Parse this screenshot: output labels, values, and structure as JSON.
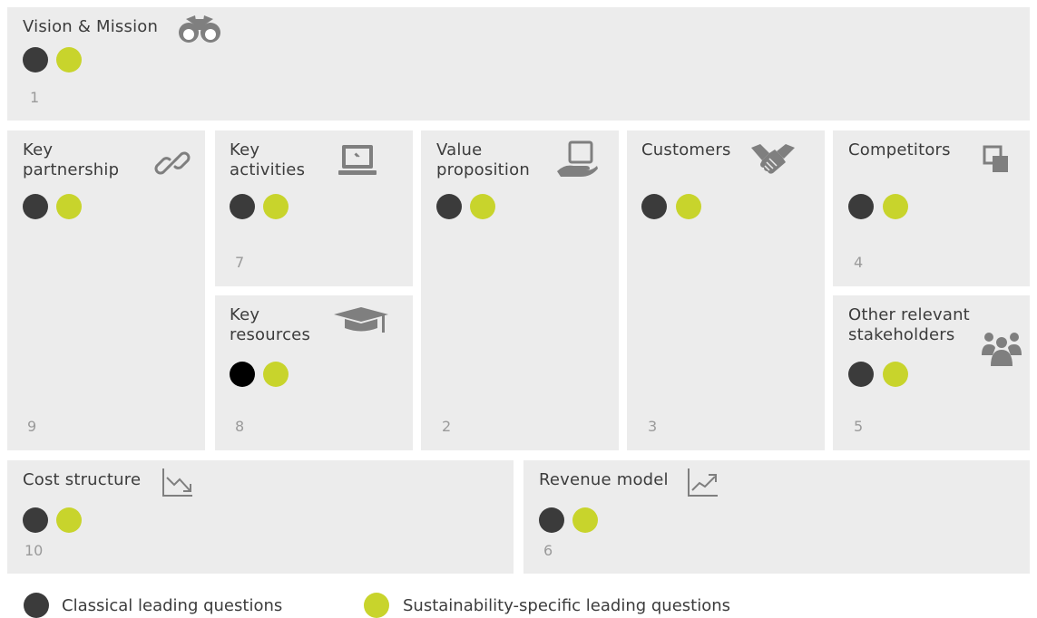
{
  "colors": {
    "classical": "#3b3b3b",
    "classical_resources": "#000000",
    "sustainability": "#c8d42c",
    "box_bg": "#ececec",
    "icon": "#7f7f7f",
    "number": "#9a9a9a"
  },
  "blocks": {
    "vision": {
      "label": "Vision & Mission",
      "number": "1",
      "icon": "binoculars-icon"
    },
    "partnership": {
      "label": "Key\npartnership",
      "number": "9",
      "icon": "link-icon"
    },
    "activities": {
      "label": "Key\nactivities",
      "number": "7",
      "icon": "laptop-icon"
    },
    "resources": {
      "label": "Key\nresources",
      "number": "8",
      "icon": "graduation-cap-icon"
    },
    "value": {
      "label": "Value\nproposition",
      "number": "2",
      "icon": "hand-device-icon"
    },
    "customers": {
      "label": "Customers",
      "number": "3",
      "icon": "handshake-icon"
    },
    "competitors": {
      "label": "Competitors",
      "number": "4",
      "icon": "overlapping-squares-icon"
    },
    "stakeholders": {
      "label": "Other relevant\nstakeholders",
      "number": "5",
      "icon": "people-group-icon"
    },
    "cost": {
      "label": "Cost structure",
      "number": "10",
      "icon": "trend-down-icon"
    },
    "revenue": {
      "label": "Revenue model",
      "number": "6",
      "icon": "trend-up-icon"
    }
  },
  "legend": {
    "classical": "Classical leading questions",
    "sustainability": "Sustainability-specific leading questions"
  }
}
